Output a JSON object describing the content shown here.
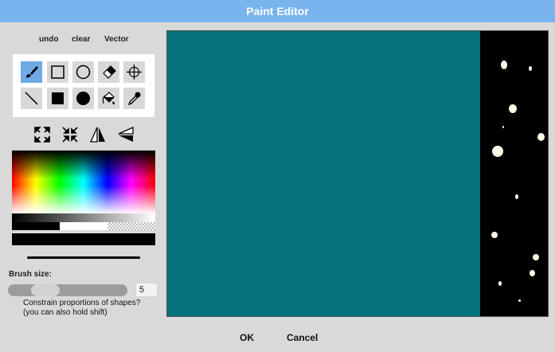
{
  "window": {
    "title": "Paint Editor"
  },
  "toolbar": {
    "undo": "undo",
    "clear": "clear",
    "vector": "Vector"
  },
  "tools": [
    {
      "icon": "brush-icon",
      "active": true
    },
    {
      "icon": "rectangle-outline-icon",
      "active": false
    },
    {
      "icon": "ellipse-outline-icon",
      "active": false
    },
    {
      "icon": "eraser-icon",
      "active": false
    },
    {
      "icon": "crosshair-icon",
      "active": false
    },
    {
      "icon": "line-icon",
      "active": false
    },
    {
      "icon": "rectangle-filled-icon",
      "active": false
    },
    {
      "icon": "ellipse-filled-icon",
      "active": false
    },
    {
      "icon": "paint-bucket-icon",
      "active": false
    },
    {
      "icon": "eyedropper-icon",
      "active": false
    }
  ],
  "transform_icons": [
    "grow-icon",
    "shrink-icon",
    "flip-horizontal-icon",
    "flip-vertical-icon"
  ],
  "colors": {
    "current": "#000000",
    "canvas_bg": "#03727b",
    "accent": "#79b4ef"
  },
  "brush": {
    "label": "Brush size:",
    "value": "5",
    "level_fraction": 0.25
  },
  "constrain": {
    "line1": "Constrain proportions of shapes?",
    "line2": "(you can also hold shift)"
  },
  "footer": {
    "ok": "OK",
    "cancel": "Cancel"
  }
}
